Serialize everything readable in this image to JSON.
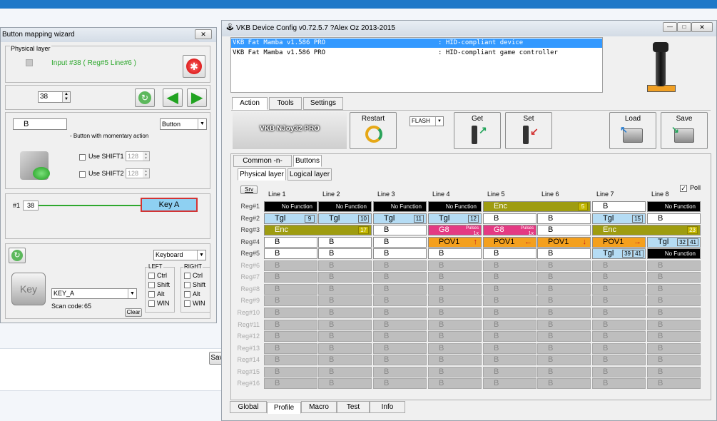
{
  "wizard": {
    "title": "Button mapping wizard",
    "physical_layer_label": "Physical layer",
    "input_text": "Input #38 ( Reg#5  Line#6 )",
    "input_number": "38",
    "button_name": "B",
    "button_type": "Button",
    "button_desc": "- Button with momentary action",
    "shift1_label": "Use SHIFT1",
    "shift1_value": "128",
    "shift2_label": "Use SHIFT2",
    "shift2_value": "128",
    "link_hash": "#1",
    "link_num": "38",
    "key_chip": "Key A",
    "output_type": "Keyboard",
    "key_icon_label": "Key",
    "key_select": "KEY_A",
    "scan_code_label": "Scan code:",
    "scan_code_value": "65",
    "clear_label": "Clear",
    "left_group": "LEFT",
    "right_group": "RIGHT",
    "modifiers": [
      "Ctrl",
      "Shift",
      "Alt",
      "WIN"
    ],
    "close_icon": "close-icon"
  },
  "behind_button": "Sav",
  "vkb": {
    "title": "VKB Device Config v0.72.5.7 ?Alex Oz 2013-2015",
    "devices": [
      {
        "name": "VKB Fat Mamba  v1.586 PRO",
        "desc": ": HID-compliant device"
      },
      {
        "name": "VKB Fat Mamba  v1.586 PRO",
        "desc": ": HID-compliant game controller"
      }
    ],
    "top_tabs": [
      "Action",
      "Tools",
      "Settings"
    ],
    "device_banner": "VKB NJoy32 PRO",
    "restart_label": "Restart",
    "flash_value": "FLASH",
    "get_label": "Get",
    "set_label": "Set",
    "load_label": "Load",
    "save_label": "Save",
    "sub_tabs": [
      "Common -n- Axes",
      "Buttons"
    ],
    "layer_tabs": [
      "Physical layer",
      "Logical layer"
    ],
    "srv_label": "Srv",
    "poll_label": "Poll",
    "columns": [
      "Line 1",
      "Line 2",
      "Line 3",
      "Line 4",
      "Line 5",
      "Line 6",
      "Line 7",
      "Line 8"
    ],
    "rows": [
      "Reg#1",
      "Reg#2",
      "Reg#3",
      "Reg#4",
      "Reg#5",
      "Reg#6",
      "Reg#7",
      "Reg#8",
      "Reg#9",
      "Reg#10",
      "Reg#11",
      "Reg#12",
      "Reg#13",
      "Reg#14",
      "Reg#15",
      "Reg#16"
    ],
    "grid": [
      [
        {
          "t": "nf",
          "l": "No Function"
        },
        {
          "t": "nf",
          "l": "No Function"
        },
        {
          "t": "nf",
          "l": "No Function"
        },
        {
          "t": "nf",
          "l": "No Function"
        },
        {
          "t": "enc",
          "l": "Enc",
          "b": "5",
          "span": 2
        },
        {
          "t": "skip"
        },
        {
          "t": "b",
          "l": "B"
        },
        {
          "t": "nf",
          "l": "No Function"
        }
      ],
      [
        {
          "t": "tgl",
          "l": "Tgl",
          "b": "9"
        },
        {
          "t": "tgl",
          "l": "Tgl",
          "b": "10"
        },
        {
          "t": "tgl",
          "l": "Tgl",
          "b": "11"
        },
        {
          "t": "tgl",
          "l": "Tgl",
          "b": "12"
        },
        {
          "t": "b",
          "l": "B"
        },
        {
          "t": "b",
          "l": "B"
        },
        {
          "t": "tgl",
          "l": "Tgl",
          "b": "15"
        },
        {
          "t": "b",
          "l": "B"
        }
      ],
      [
        {
          "t": "enc",
          "l": "Enc",
          "b": "17",
          "span": 2
        },
        {
          "t": "skip"
        },
        {
          "t": "b",
          "l": "B"
        },
        {
          "t": "g8",
          "l": "G8",
          "p": "Pulses",
          "x": "1x"
        },
        {
          "t": "g8",
          "l": "G8",
          "p": "Pulses",
          "x": "1x"
        },
        {
          "t": "b",
          "l": "B"
        },
        {
          "t": "enc",
          "l": "Enc",
          "b": "23",
          "span": 2
        },
        {
          "t": "skip"
        }
      ],
      [
        {
          "t": "b",
          "l": "B"
        },
        {
          "t": "b",
          "l": "B"
        },
        {
          "t": "b",
          "l": "B"
        },
        {
          "t": "pov",
          "l": "POV1",
          "a": "↑"
        },
        {
          "t": "pov",
          "l": "POV1",
          "a": "←"
        },
        {
          "t": "pov",
          "l": "POV1",
          "a": "↓"
        },
        {
          "t": "pov",
          "l": "POV1",
          "a": "→"
        },
        {
          "t": "tgl",
          "l": "Tgl",
          "b": "32",
          "b2": "41"
        }
      ],
      [
        {
          "t": "b",
          "l": "B"
        },
        {
          "t": "b",
          "l": "B"
        },
        {
          "t": "b",
          "l": "B"
        },
        {
          "t": "b",
          "l": "B"
        },
        {
          "t": "b",
          "l": "B"
        },
        {
          "t": "b",
          "l": "B"
        },
        {
          "t": "tgl",
          "l": "Tgl",
          "b": "39",
          "b2": "41"
        },
        {
          "t": "nf",
          "l": "No Function"
        }
      ]
    ],
    "gray_label": "B",
    "bottom_tabs": [
      "Global",
      "Profile",
      "Macro",
      "Test",
      "Info"
    ],
    "active_bottom_tab": "Profile"
  }
}
